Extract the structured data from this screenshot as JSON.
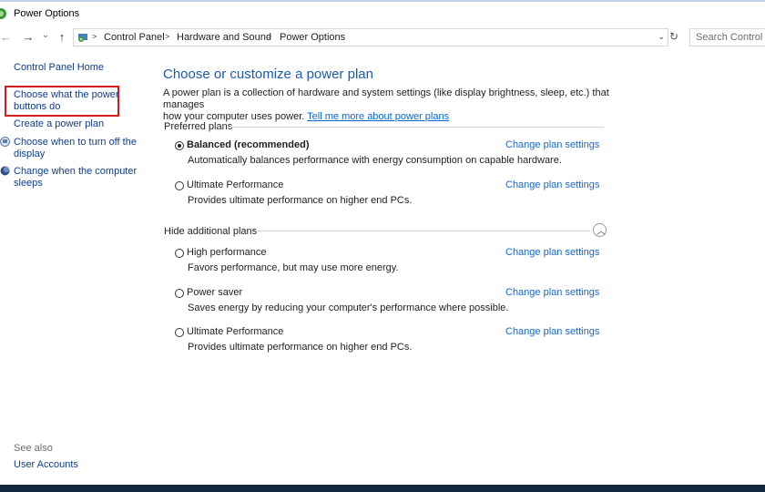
{
  "window": {
    "title": "Power Options"
  },
  "navigation": {
    "back_icon": "←",
    "forward_icon": "→",
    "recent_icon": "⌄",
    "up_icon": "↑",
    "breadcrumbs": [
      "Control Panel",
      "Hardware and Sound",
      "Power Options"
    ],
    "separator": ">",
    "dropdown_icon": "⌄",
    "refresh_icon": "↻",
    "search_placeholder": "Search Control Pa"
  },
  "sidebar": {
    "home": "Control Panel Home",
    "tasks": [
      {
        "line1": "Choose what the power",
        "line2": "buttons do",
        "icon": "none"
      },
      {
        "line1": "Create a power plan",
        "line2": "",
        "icon": "none"
      },
      {
        "line1": "Choose when to turn off the",
        "line2": "display",
        "icon": "monitor-icon"
      },
      {
        "line1": "Change when the computer",
        "line2": "sleeps",
        "icon": "moon-icon"
      }
    ],
    "see_also": "See also",
    "see_also_links": [
      "User Accounts"
    ]
  },
  "main": {
    "title": "Choose or customize a power plan",
    "description_line1": "A power plan is a collection of hardware and system settings (like display brightness, sleep, etc.) that manages",
    "description_line2": "how your computer uses power.",
    "description_link": "Tell me more about power plans",
    "preferred_heading": "Preferred plans",
    "additional_heading": "Hide additional plans",
    "collapse_icon": "︿",
    "change_label": "Change plan settings",
    "preferred_plans": [
      {
        "name": "Balanced (recommended)",
        "desc": "Automatically balances performance with energy consumption on capable hardware.",
        "selected": true
      },
      {
        "name": "Ultimate Performance",
        "desc": "Provides ultimate performance on higher end PCs.",
        "selected": false
      }
    ],
    "additional_plans": [
      {
        "name": "High performance",
        "desc": "Favors performance, but may use more energy.",
        "selected": false
      },
      {
        "name": "Power saver",
        "desc": "Saves energy by reducing your computer's performance where possible.",
        "selected": false
      },
      {
        "name": "Ultimate Performance",
        "desc": "Provides ultimate performance on higher end PCs.",
        "selected": false
      }
    ]
  },
  "colors": {
    "link": "#0f3c8a",
    "title_blue": "#1d5aa9",
    "highlight_border": "#d21d1d",
    "taskbar": "#12263d"
  }
}
